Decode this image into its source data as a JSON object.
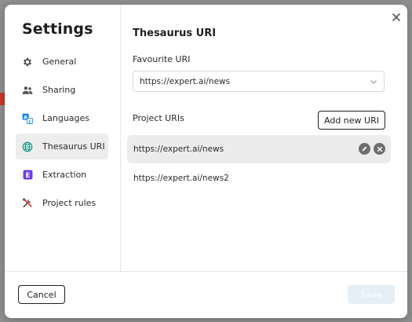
{
  "dialog": {
    "title": "Settings"
  },
  "sidebar": {
    "items": [
      {
        "label": "General",
        "icon": "gear-icon",
        "active": false
      },
      {
        "label": "Sharing",
        "icon": "users-icon",
        "active": false
      },
      {
        "label": "Languages",
        "icon": "translate-icon",
        "active": false
      },
      {
        "label": "Thesaurus URI",
        "icon": "globe-icon",
        "active": true
      },
      {
        "label": "Extraction",
        "icon": "extraction-icon",
        "active": false
      },
      {
        "label": "Project rules",
        "icon": "tools-icon",
        "active": false
      }
    ]
  },
  "main": {
    "section_title": "Thesaurus URI",
    "favourite_label": "Favourite URI",
    "favourite_value": "https://expert.ai/news",
    "project_uris_label": "Project URIs",
    "add_button_label": "Add new URI",
    "uris": [
      {
        "value": "https://expert.ai/news",
        "highlighted": true
      },
      {
        "value": "https://expert.ai/news2",
        "highlighted": false
      }
    ]
  },
  "footer": {
    "cancel_label": "Cancel",
    "save_label": "Save"
  },
  "colors": {
    "backdrop": "#8f8f8f",
    "active_nav": "#ededed",
    "row_highlight": "#ececec",
    "languages_icon": "#1e88e5",
    "extraction_icon": "#6a3de8",
    "globe_icon": "#1e9a8a",
    "save_disabled": "#e6eef8"
  }
}
